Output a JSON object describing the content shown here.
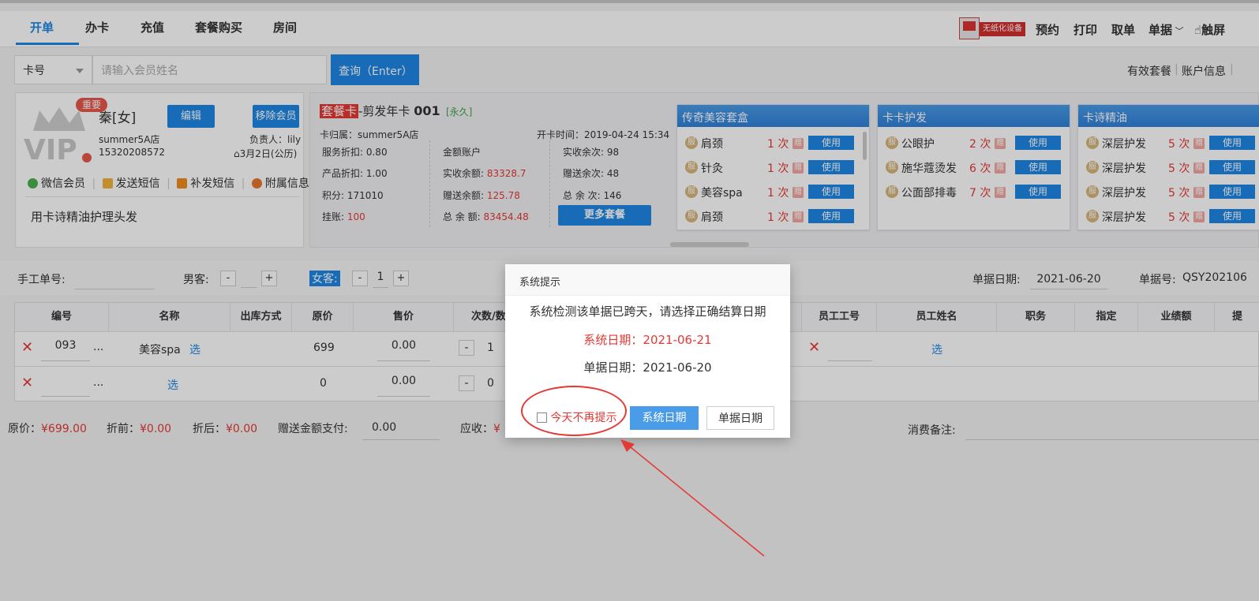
{
  "tabs": [
    "开单",
    "办卡",
    "充值",
    "套餐购买",
    "房间"
  ],
  "top_right": {
    "device_label": "无纸化设备",
    "items": [
      "预约",
      "打印",
      "取单",
      "单据",
      "触屏"
    ]
  },
  "search": {
    "select_value": "卡号",
    "name_placeholder": "请输入会员姓名",
    "query_label": "查询（Enter）"
  },
  "right_links": [
    "有效套餐",
    "账户信息"
  ],
  "member": {
    "tag": "重要",
    "vip_text": "VIP",
    "name": "秦[女]",
    "store": "summer5A店",
    "phone": "15320208572",
    "manager": "负责人：lily",
    "birthday": "3月2日(公历)",
    "edit_label": "编辑",
    "remove_label": "移除会员",
    "actions": [
      "微信会员",
      "发送短信",
      "补发短信",
      "附属信息"
    ],
    "note": "用卡诗精油护理头发"
  },
  "card": {
    "type_tag": "套餐卡",
    "name": "-剪发年卡",
    "number": "001",
    "validity": "[永久]",
    "owner_store": "卡归属：summer5A店",
    "open_time": "开卡时间：2019-04-24 15:34",
    "service_discount": "服务折扣: 0.80",
    "product_discount": "产品折扣: 1.00",
    "points": "积分: 171010",
    "credit_label": "挂账:",
    "credit_value": "100",
    "account_title": "金额账户",
    "paid_balance_label": "实收余额:",
    "paid_balance": "83328.7",
    "gift_balance_label": "赠送余额:",
    "gift_balance": "125.78",
    "total_balance_label": "总 余 额:",
    "total_balance": "83454.48",
    "paid_times": "实收余次: 98",
    "gift_times": "赠送余次: 48",
    "total_times": "总 余 次: 146",
    "more_label": "更多套餐"
  },
  "packages": [
    {
      "title": "传奇美容套盒",
      "rows": [
        {
          "badge": "服",
          "name": "肩颈",
          "count": "1 次",
          "gift": "赠",
          "use": "使用"
        },
        {
          "badge": "服",
          "name": "针灸",
          "count": "1 次",
          "gift": "赠",
          "use": "使用"
        },
        {
          "badge": "服",
          "name": "美容spa",
          "count": "1 次",
          "gift": "赠",
          "use": "使用"
        },
        {
          "badge": "服",
          "name": "肩颈",
          "count": "1 次",
          "gift": "赠",
          "use": "使用"
        }
      ]
    },
    {
      "title": "卡卡护发",
      "rows": [
        {
          "badge": "服",
          "name": "公眼护",
          "count": "2 次",
          "gift": "赠",
          "use": "使用"
        },
        {
          "badge": "服",
          "name": "施华蔻烫发",
          "count": "6 次",
          "gift": "赠",
          "use": "使用"
        },
        {
          "badge": "服",
          "name": "公面部排毒",
          "count": "7 次",
          "gift": "赠",
          "use": "使用"
        }
      ]
    },
    {
      "title": "卡诗精油",
      "rows": [
        {
          "badge": "服",
          "name": "深层护发",
          "count": "5 次",
          "gift": "赠",
          "use": "使用"
        },
        {
          "badge": "服",
          "name": "深层护发",
          "count": "5 次",
          "gift": "赠",
          "use": "使用"
        },
        {
          "badge": "服",
          "name": "深层护发",
          "count": "5 次",
          "gift": "赠",
          "use": "使用"
        },
        {
          "badge": "服",
          "name": "深层护发",
          "count": "5 次",
          "gift": "赠",
          "use": "使用"
        }
      ]
    }
  ],
  "order": {
    "manual_no_label": "手工单号:",
    "male_label": "男客:",
    "female_label": "女客:",
    "female_count": "1",
    "minus": "-",
    "plus": "+",
    "date_label": "单据日期:",
    "date_value": "2021-06-20",
    "bill_no_label": "单据号:",
    "bill_no_value": "QSY202106"
  },
  "table": {
    "headers": [
      "编号",
      "名称",
      "出库方式",
      "原价",
      "售价",
      "次数/数量",
      "员工工号",
      "员工姓名",
      "职务",
      "指定",
      "业绩额",
      "提"
    ],
    "rows": [
      {
        "code": "093",
        "more": "...",
        "name": "美容spa",
        "choose": "选",
        "price": "699",
        "sale": "0.00",
        "qty": "1",
        "staff_choose": "选"
      },
      {
        "code": "",
        "more": "...",
        "name": "",
        "choose": "选",
        "price": "0",
        "sale": "0.00",
        "qty": "0",
        "staff_choose": ""
      }
    ]
  },
  "summary": {
    "orig_label": "原价：",
    "orig_value": "¥699.00",
    "before_label": "折前：",
    "before_value": "¥0.00",
    "after_label": "折后：",
    "after_value": "¥0.00",
    "gift_pay_label": "赠送金额支付:",
    "gift_pay_value": "0.00",
    "due_label": "应收：",
    "due_value": "¥",
    "remark_label": "消费备注:"
  },
  "dialog": {
    "title": "系统提示",
    "message": "系统检测该单据已跨天，请选择正确结算日期",
    "system_date": "系统日期：2021-06-21",
    "bill_date": "单据日期：2021-06-20",
    "checkbox_label": "今天不再提示",
    "btn_system": "系统日期",
    "btn_bill": "单据日期"
  },
  "colors": {
    "accent": "#1e88e5",
    "danger": "#e53935"
  }
}
